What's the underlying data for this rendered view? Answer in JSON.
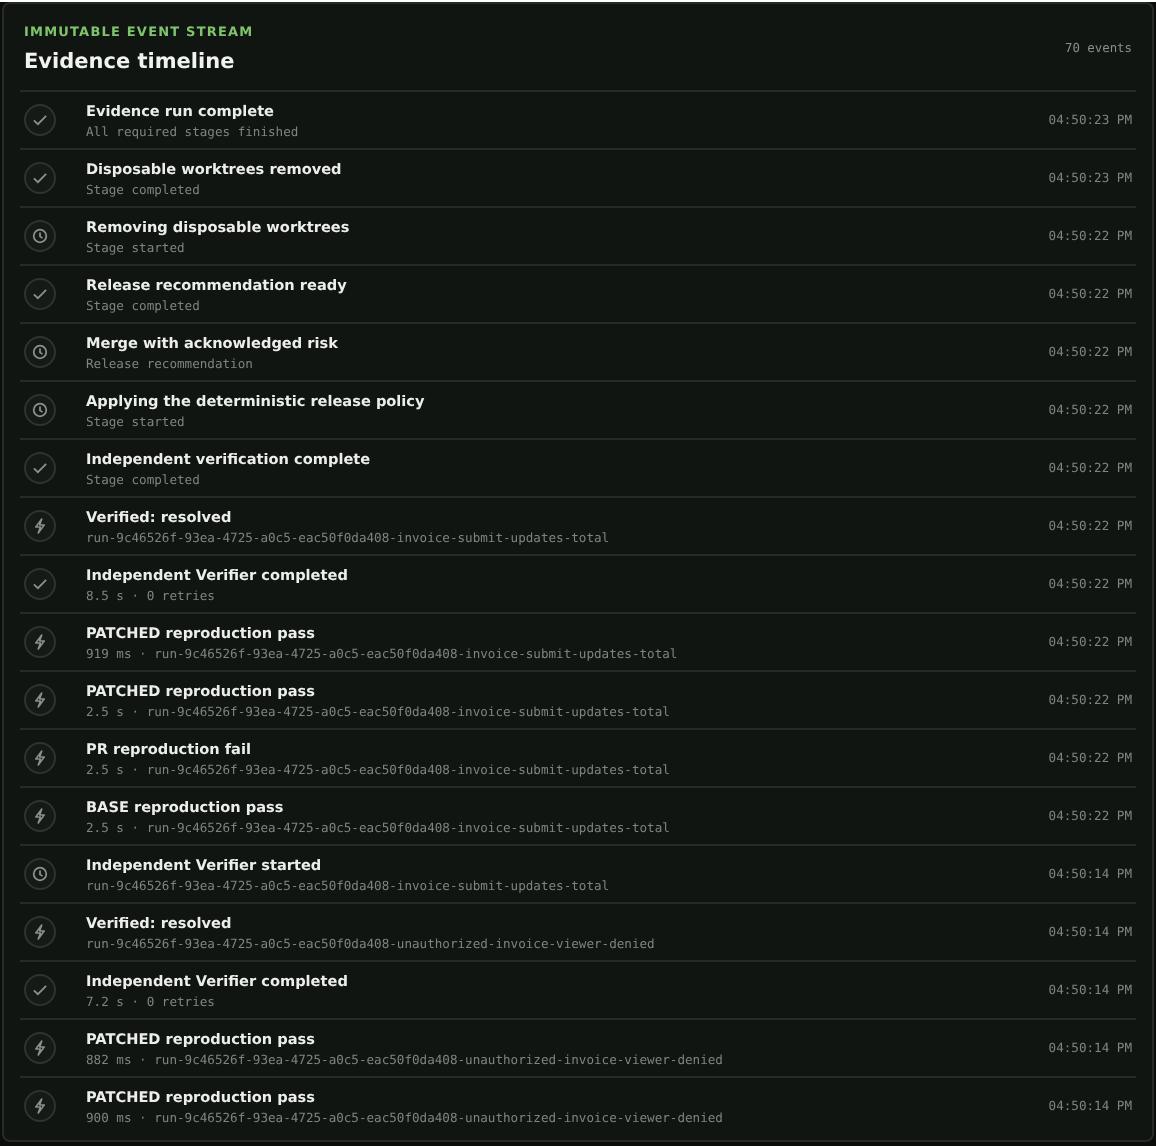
{
  "header": {
    "eyebrow": "IMMUTABLE EVENT STREAM",
    "title": "Evidence timeline",
    "count": "70 events"
  },
  "events": [
    {
      "kind": "check",
      "title": "Evidence run complete",
      "detail": "All required stages finished",
      "time": "04:50:23 PM"
    },
    {
      "kind": "check",
      "title": "Disposable worktrees removed",
      "detail": "Stage completed",
      "time": "04:50:23 PM"
    },
    {
      "kind": "clock",
      "title": "Removing disposable worktrees",
      "detail": "Stage started",
      "time": "04:50:22 PM"
    },
    {
      "kind": "check",
      "title": "Release recommendation ready",
      "detail": "Stage completed",
      "time": "04:50:22 PM"
    },
    {
      "kind": "clock",
      "title": "Merge with acknowledged risk",
      "detail": "Release recommendation",
      "time": "04:50:22 PM"
    },
    {
      "kind": "clock",
      "title": "Applying the deterministic release policy",
      "detail": "Stage started",
      "time": "04:50:22 PM"
    },
    {
      "kind": "check",
      "title": "Independent verification complete",
      "detail": "Stage completed",
      "time": "04:50:22 PM"
    },
    {
      "kind": "bolt",
      "title": "Verified: resolved",
      "detail": "run-9c46526f-93ea-4725-a0c5-eac50f0da408-invoice-submit-updates-total",
      "time": "04:50:22 PM"
    },
    {
      "kind": "check",
      "title": "Independent Verifier completed",
      "detail": "8.5 s · 0 retries",
      "time": "04:50:22 PM"
    },
    {
      "kind": "bolt",
      "title": "PATCHED reproduction pass",
      "detail": "919 ms · run-9c46526f-93ea-4725-a0c5-eac50f0da408-invoice-submit-updates-total",
      "time": "04:50:22 PM"
    },
    {
      "kind": "bolt",
      "title": "PATCHED reproduction pass",
      "detail": "2.5 s · run-9c46526f-93ea-4725-a0c5-eac50f0da408-invoice-submit-updates-total",
      "time": "04:50:22 PM"
    },
    {
      "kind": "bolt",
      "title": "PR reproduction fail",
      "detail": "2.5 s · run-9c46526f-93ea-4725-a0c5-eac50f0da408-invoice-submit-updates-total",
      "time": "04:50:22 PM"
    },
    {
      "kind": "bolt",
      "title": "BASE reproduction pass",
      "detail": "2.5 s · run-9c46526f-93ea-4725-a0c5-eac50f0da408-invoice-submit-updates-total",
      "time": "04:50:22 PM"
    },
    {
      "kind": "clock",
      "title": "Independent Verifier started",
      "detail": "run-9c46526f-93ea-4725-a0c5-eac50f0da408-invoice-submit-updates-total",
      "time": "04:50:14 PM"
    },
    {
      "kind": "bolt",
      "title": "Verified: resolved",
      "detail": "run-9c46526f-93ea-4725-a0c5-eac50f0da408-unauthorized-invoice-viewer-denied",
      "time": "04:50:14 PM"
    },
    {
      "kind": "check",
      "title": "Independent Verifier completed",
      "detail": "7.2 s · 0 retries",
      "time": "04:50:14 PM"
    },
    {
      "kind": "bolt",
      "title": "PATCHED reproduction pass",
      "detail": "882 ms · run-9c46526f-93ea-4725-a0c5-eac50f0da408-unauthorized-invoice-viewer-denied",
      "time": "04:50:14 PM"
    },
    {
      "kind": "bolt",
      "title": "PATCHED reproduction pass",
      "detail": "900 ms · run-9c46526f-93ea-4725-a0c5-eac50f0da408-unauthorized-invoice-viewer-denied",
      "time": "04:50:14 PM"
    }
  ]
}
